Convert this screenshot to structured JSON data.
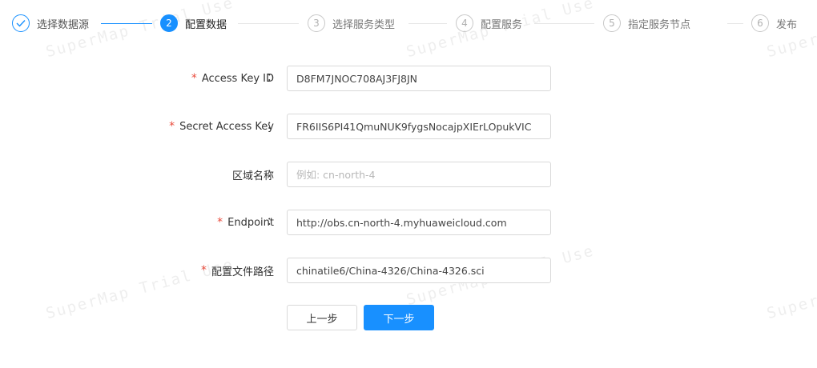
{
  "steps": [
    {
      "label": "选择数据源",
      "number": "1",
      "status": "done"
    },
    {
      "label": "配置数据",
      "number": "2",
      "status": "active"
    },
    {
      "label": "选择服务类型",
      "number": "3",
      "status": "wait"
    },
    {
      "label": "配置服务",
      "number": "4",
      "status": "wait"
    },
    {
      "label": "指定服务节点",
      "number": "5",
      "status": "wait"
    },
    {
      "label": "发布",
      "number": "6",
      "status": "wait"
    }
  ],
  "form": {
    "colon": "：",
    "required_mark": "*",
    "fields": [
      {
        "label": "Access Key ID",
        "required": true,
        "value": "D8FM7JNOC708AJ3FJ8JN",
        "placeholder": ""
      },
      {
        "label": "Secret Access Key",
        "required": true,
        "value": "FR6IIS6PI41QmuNUK9fygsNocajpXIErLOpukVIC",
        "placeholder": ""
      },
      {
        "label": "区域名称",
        "required": false,
        "value": "",
        "placeholder": "例如: cn-north-4"
      },
      {
        "label": "Endpoint",
        "required": true,
        "value": "http://obs.cn-north-4.myhuaweicloud.com",
        "placeholder": ""
      },
      {
        "label": "配置文件路径",
        "required": true,
        "value": "chinatile6/China-4326/China-4326.sci",
        "placeholder": ""
      }
    ]
  },
  "buttons": {
    "prev": "上一步",
    "next": "下一步"
  },
  "watermark": {
    "text": "SuperMap Trial Use"
  },
  "colors": {
    "primary": "#1890ff",
    "required": "#e94b3c",
    "border": "#d9d9d9"
  }
}
